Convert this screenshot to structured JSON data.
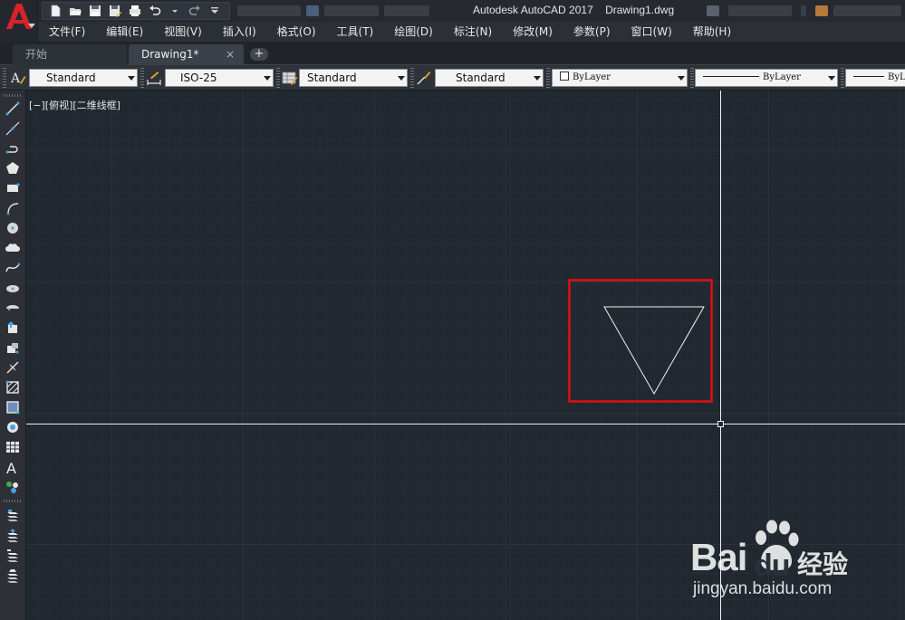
{
  "window": {
    "title": "Autodesk AutoCAD 2017    Drawing1.dwg"
  },
  "menu": [
    {
      "label": "文件(F)"
    },
    {
      "label": "编辑(E)"
    },
    {
      "label": "视图(V)"
    },
    {
      "label": "插入(I)"
    },
    {
      "label": "格式(O)"
    },
    {
      "label": "工具(T)"
    },
    {
      "label": "绘图(D)"
    },
    {
      "label": "标注(N)"
    },
    {
      "label": "修改(M)"
    },
    {
      "label": "参数(P)"
    },
    {
      "label": "窗口(W)"
    },
    {
      "label": "帮助(H)"
    }
  ],
  "quick_access": [
    "new-icon",
    "open-icon",
    "save-icon",
    "save-as-icon",
    "plot-icon",
    "undo-icon",
    "redo-icon",
    "customize-icon"
  ],
  "tabs": [
    {
      "label": "开始",
      "active": false
    },
    {
      "label": "Drawing1*",
      "active": true,
      "close": "×"
    }
  ],
  "tab_add": "+",
  "style_toolbar": {
    "text_style": "Standard",
    "dim_style": "ISO-25",
    "table_style": "Standard",
    "mleader_style": "Standard",
    "color": "ByLayer",
    "linetype": "ByLayer",
    "lineweight": "ByLa"
  },
  "left_tools": [
    "line-icon",
    "construction-line-icon",
    "polyline-icon",
    "polygon-icon",
    "rectangle-icon",
    "arc-icon",
    "circle-icon",
    "revision-cloud-icon",
    "spline-icon",
    "ellipse-icon",
    "ellipse-arc-icon",
    "insert-block-icon",
    "make-block-icon",
    "point-icon",
    "hatch-icon",
    "gradient-icon",
    "region-icon",
    "table-icon",
    "multiline-text-icon",
    "add-selected-icon",
    "layer-properties-icon",
    "layer-states-icon",
    "layer-isolate-icon",
    "layer-walk-icon"
  ],
  "viewport": {
    "label": "[−][俯视][二维线框]"
  },
  "colors": {
    "canvas_bg": "#212830",
    "highlight_box": "#e01010",
    "crosshair": "#ffffff"
  },
  "watermark": {
    "word": "Bai",
    "word2": "du",
    "cn": "经验",
    "url": "jingyan.baidu.com"
  }
}
